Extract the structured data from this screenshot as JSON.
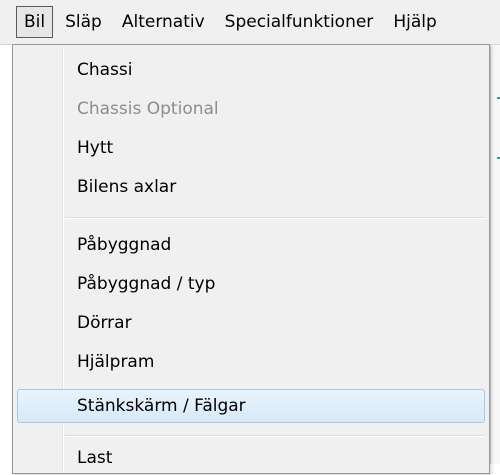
{
  "menubar": {
    "items": [
      {
        "label": "Bil"
      },
      {
        "label": "Släp"
      },
      {
        "label": "Alternativ"
      },
      {
        "label": "Specialfunktioner"
      },
      {
        "label": "Hjälp"
      }
    ]
  },
  "dropdown": {
    "items": [
      {
        "label": "Chassi",
        "enabled": true
      },
      {
        "label": "Chassis Optional",
        "enabled": false
      },
      {
        "label": "Hytt",
        "enabled": true
      },
      {
        "label": "Bilens axlar",
        "enabled": true
      },
      {
        "label": "Påbyggnad",
        "enabled": true
      },
      {
        "label": "Påbyggnad / typ",
        "enabled": true
      },
      {
        "label": "Dörrar",
        "enabled": true
      },
      {
        "label": "Hjälpram",
        "enabled": true
      },
      {
        "label": "Stänkskärm / Fälgar",
        "enabled": true,
        "highlighted": true
      },
      {
        "label": "Last",
        "enabled": true
      }
    ]
  },
  "colors": {
    "menu_background": "#f0f0f0",
    "highlight_background": "#dcecfb",
    "highlight_border": "#a8c8e6",
    "disabled_text": "#8d8d8d"
  }
}
